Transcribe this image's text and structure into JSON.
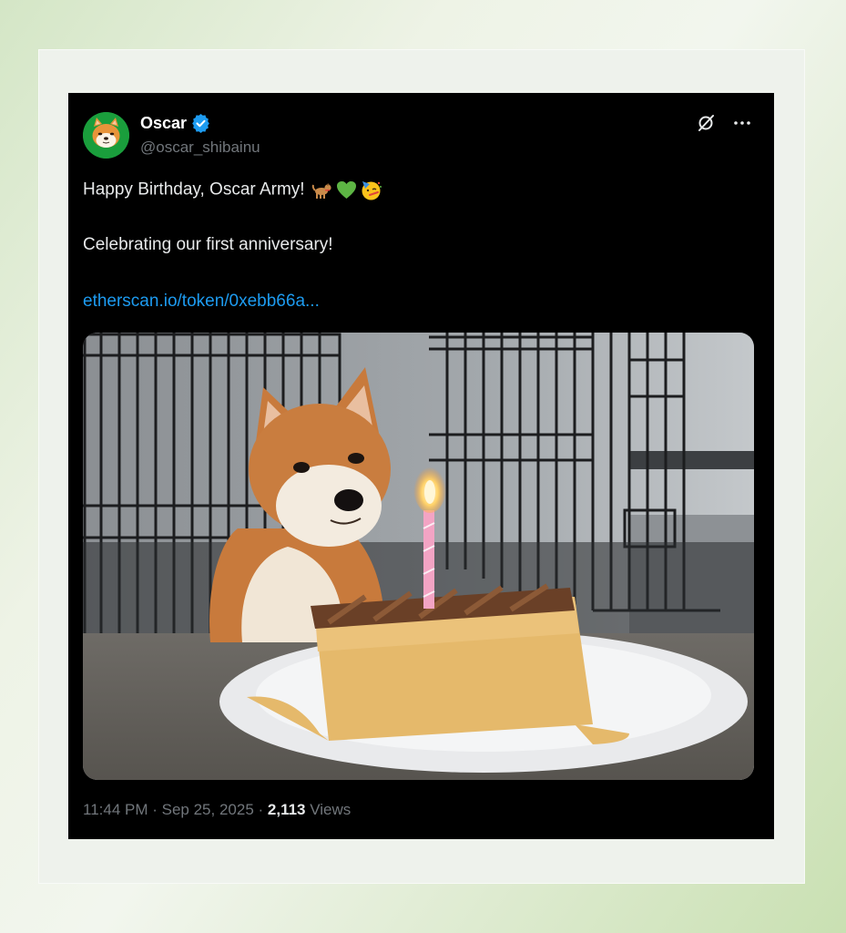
{
  "tweet": {
    "author": {
      "name": "Oscar",
      "handle": "@oscar_shibainu",
      "verified": true
    },
    "text_line_1": "Happy Birthday, Oscar Army!",
    "text_line_1_emojis": [
      "dog-emoji",
      "green-heart-emoji",
      "partying-face-emoji"
    ],
    "text_line_2": "Celebrating our first anniversary!",
    "link_text": "etherscan.io/token/0xebb66a...",
    "media": {
      "type": "photo",
      "subject": "shiba-inu-dog-with-birthday-cake"
    },
    "footer": {
      "time": "11:44 PM",
      "separator": " · ",
      "date": "Sep 25, 2025",
      "views_count": "2,113",
      "views_label": " Views"
    }
  },
  "icons": [
    "grok-icon",
    "more-options-icon",
    "verified-badge-icon"
  ],
  "colors": {
    "card_background": "#000000",
    "link": "#1d9bf0",
    "muted_text": "#71767b",
    "verified": "#1d9bf0",
    "page_background": "#e2edd6"
  }
}
